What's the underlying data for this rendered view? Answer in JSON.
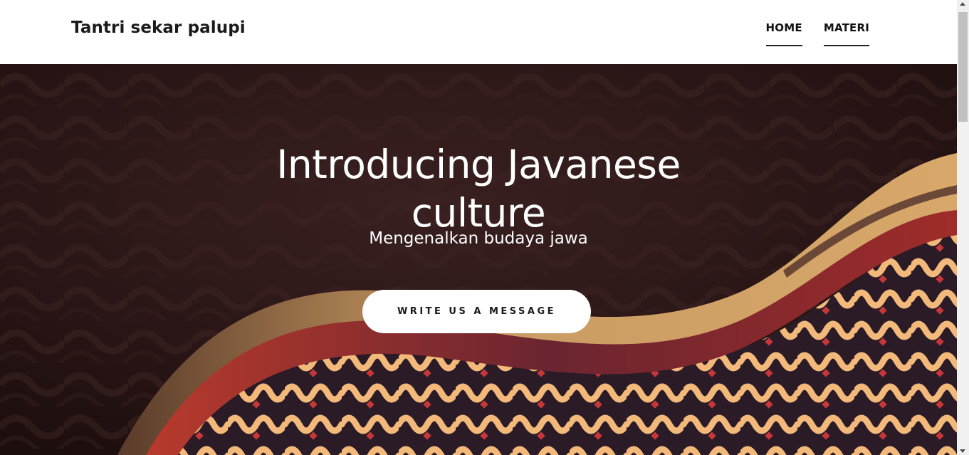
{
  "header": {
    "brand": "Tantri sekar palupi",
    "nav": [
      {
        "label": "HOME"
      },
      {
        "label": "MATERI"
      }
    ]
  },
  "hero": {
    "title_line1": "Introducing Javanese",
    "title_line2": "culture",
    "subtitle": "Mengenalkan budaya jawa",
    "cta_label": "WRITE US A MESSAGE",
    "background_description_icon": "batik-pattern-background",
    "colors": {
      "dark": "#2a1414",
      "gold": "#c89a62",
      "red": "#9e2c2a",
      "cream": "#f2b97b"
    }
  }
}
